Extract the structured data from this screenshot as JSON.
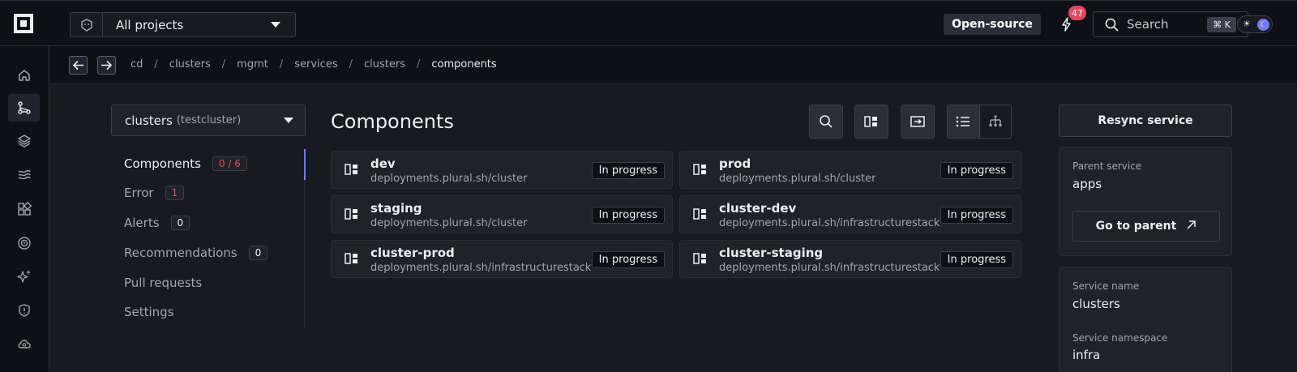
{
  "header": {
    "project_select": "All projects",
    "opensource_label": "Open-source",
    "notifications_count": "47",
    "search_label": "Search",
    "search_shortcut": "⌘ K"
  },
  "sidenav": {
    "items": [
      "home-icon",
      "git-icon",
      "layers-icon",
      "flow-icon",
      "catalog-icon",
      "radar-icon",
      "sparkle-icon",
      "shield-icon",
      "cloud-icon"
    ],
    "active_index": 1
  },
  "breadcrumbs": [
    "cd",
    "clusters",
    "mgmt",
    "services",
    "clusters",
    "components"
  ],
  "service_select": {
    "name": "clusters",
    "cluster": "(testcluster)"
  },
  "subnav": [
    {
      "label": "Components",
      "count": "0 / 6"
    },
    {
      "label": "Error",
      "count": "1"
    },
    {
      "label": "Alerts",
      "count": "0"
    },
    {
      "label": "Recommendations",
      "count": "0"
    },
    {
      "label": "Pull requests"
    },
    {
      "label": "Settings"
    }
  ],
  "main": {
    "title": "Components",
    "components": [
      {
        "name": "dev",
        "kind": "deployments.plural.sh/cluster",
        "status": "In progress"
      },
      {
        "name": "prod",
        "kind": "deployments.plural.sh/cluster",
        "status": "In progress"
      },
      {
        "name": "staging",
        "kind": "deployments.plural.sh/cluster",
        "status": "In progress"
      },
      {
        "name": "cluster-dev",
        "kind": "deployments.plural.sh/infrastructurestack",
        "status": "In progress"
      },
      {
        "name": "cluster-prod",
        "kind": "deployments.plural.sh/infrastructurestack",
        "status": "In progress"
      },
      {
        "name": "cluster-staging",
        "kind": "deployments.plural.sh/infrastructurestack",
        "status": "In progress"
      }
    ]
  },
  "sidebar": {
    "resync_label": "Resync service",
    "parent_service_label": "Parent service",
    "parent_service_value": "apps",
    "go_to_parent_label": "Go to parent",
    "service_name_label": "Service name",
    "service_name_value": "clusters",
    "service_namespace_label": "Service namespace",
    "service_namespace_value": "infra"
  },
  "colors": {
    "accent": "#747af6",
    "danger": "#e0495f"
  }
}
